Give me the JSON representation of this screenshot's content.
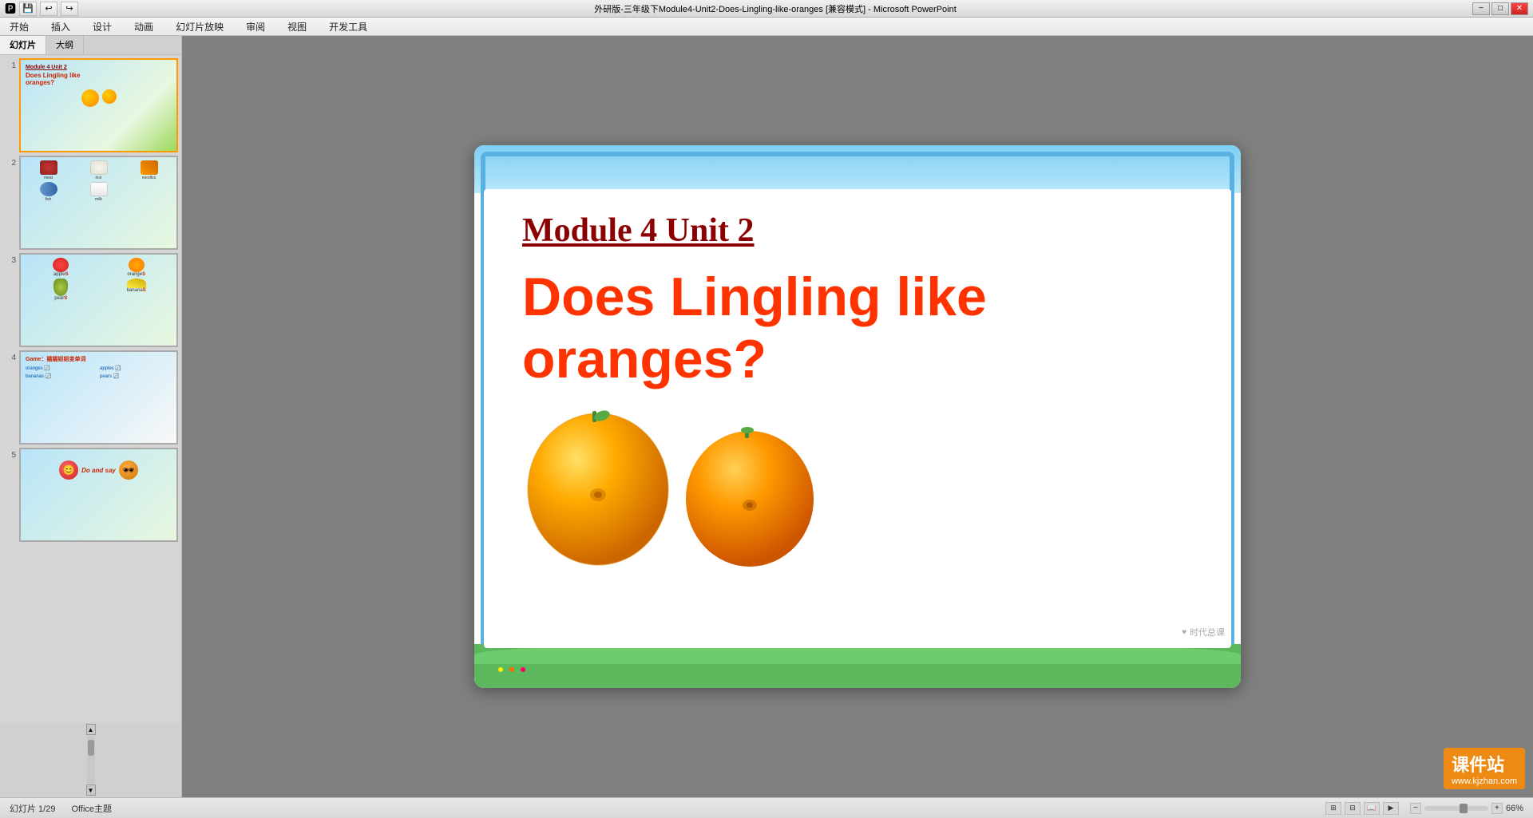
{
  "titlebar": {
    "text": "外研版-三年级下Module4-Unit2-Does-Lingling-like-oranges [兼容模式] - Microsoft PowerPoint",
    "min_btn": "−",
    "max_btn": "□",
    "close_btn": "✕"
  },
  "quicktoolbar": {
    "save_icon": "💾",
    "undo_icon": "↩",
    "redo_icon": "↪"
  },
  "menubar": {
    "items": [
      "开始",
      "插入",
      "设计",
      "动画",
      "幻灯片放映",
      "审阅",
      "视图",
      "开发工具"
    ]
  },
  "panel": {
    "tab1": "幻灯片",
    "tab2": "大纲"
  },
  "slides": [
    {
      "num": "1",
      "selected": true,
      "label": "slide-1-oranges"
    },
    {
      "num": "2",
      "selected": false,
      "label": "slide-2-food"
    },
    {
      "num": "3",
      "selected": false,
      "label": "slide-3-fruits"
    },
    {
      "num": "4",
      "selected": false,
      "label": "slide-4-game"
    },
    {
      "num": "5",
      "selected": false,
      "label": "slide-5-do-say"
    }
  ],
  "slide2_foods": [
    {
      "label": "meat",
      "row": 1
    },
    {
      "label": "rice",
      "row": 1
    },
    {
      "label": "noodles",
      "row": 1
    },
    {
      "label": "fish",
      "row": 2
    },
    {
      "label": "milk",
      "row": 2
    }
  ],
  "slide3_fruits": [
    {
      "label": "appleS"
    },
    {
      "label": "orangeS"
    },
    {
      "label": "pearS"
    },
    {
      "label": "bananaS"
    }
  ],
  "slide4": {
    "game_title": "Game：嬉嬉姐姐变单词",
    "words": [
      "oranges",
      "apples",
      "bananas",
      "pears"
    ]
  },
  "slide5": {
    "text": "Do and say"
  },
  "main_slide": {
    "title": "Module 4  Unit 2",
    "question_line1": "Does Lingling like",
    "question_line2": "oranges?",
    "watermark": "时代总课"
  },
  "statusbar": {
    "slide_info": "幻灯片 1/29",
    "theme": "Office主题"
  },
  "kjzhan": {
    "line1": "课件站",
    "line2": "www.kjzhan.com"
  }
}
